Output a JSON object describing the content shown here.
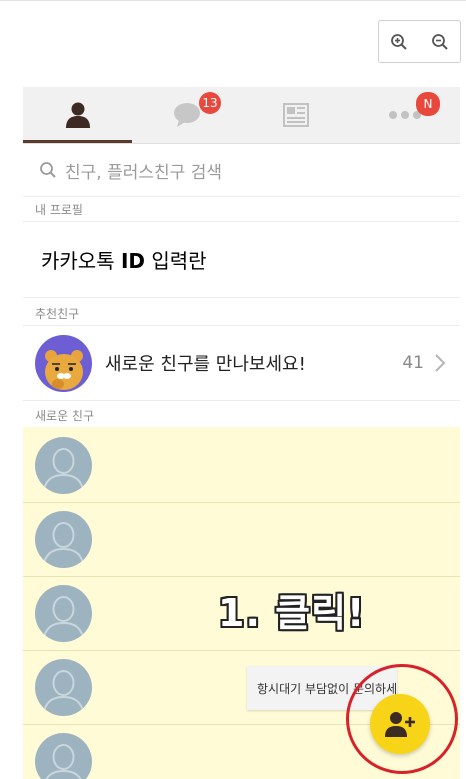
{
  "tabs": [
    {
      "name": "friends",
      "icon": "person-icon",
      "active": true
    },
    {
      "name": "chats",
      "icon": "chat-bubble-icon",
      "badge": "13"
    },
    {
      "name": "channel",
      "icon": "news-icon"
    },
    {
      "name": "more",
      "icon": "more-dots-icon",
      "badge": "N"
    }
  ],
  "search": {
    "placeholder": "친구, 플러스친구 검색"
  },
  "sections": {
    "my_profile": "내 프로필",
    "recommended": "추천친구",
    "new_friends": "새로운 친구"
  },
  "profile": {
    "prefix": "카카오톡 ",
    "id_label": "ID",
    "suffix": " 입력란"
  },
  "recommended_row": {
    "title": "새로운 친구를 만나보세요!",
    "count": "41"
  },
  "annotation": {
    "text": "1. 클릭!"
  },
  "tooltip": {
    "text": "항시대기 부담없이 문의하세요."
  },
  "colors": {
    "accent_yellow": "#f7d417",
    "badge_red": "#e9483c",
    "highlight_red": "#d7222a"
  }
}
